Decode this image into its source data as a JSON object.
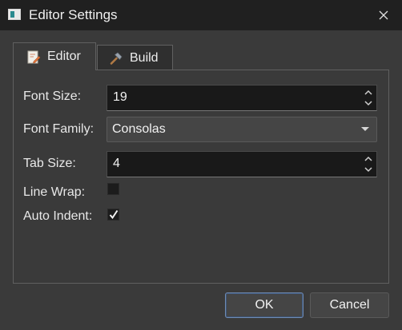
{
  "window": {
    "title": "Editor Settings"
  },
  "tabs": [
    {
      "label": "Editor",
      "icon": "pencil-note-icon",
      "selected": true
    },
    {
      "label": "Build",
      "icon": "hammer-icon",
      "selected": false
    }
  ],
  "editor": {
    "font_size": {
      "label": "Font Size:",
      "value": "19"
    },
    "font_family": {
      "label": "Font Family:",
      "value": "Consolas"
    },
    "tab_size": {
      "label": "Tab Size:",
      "value": "4"
    },
    "line_wrap": {
      "label": "Line Wrap:",
      "checked": false
    },
    "auto_indent": {
      "label": "Auto Indent:",
      "checked": true
    }
  },
  "buttons": {
    "ok": "OK",
    "cancel": "Cancel"
  },
  "colors": {
    "title_bar": "#202020",
    "dialog_bg": "#3a3a3a",
    "field_bg": "#191919",
    "accent_focus": "#6f8bb3"
  }
}
